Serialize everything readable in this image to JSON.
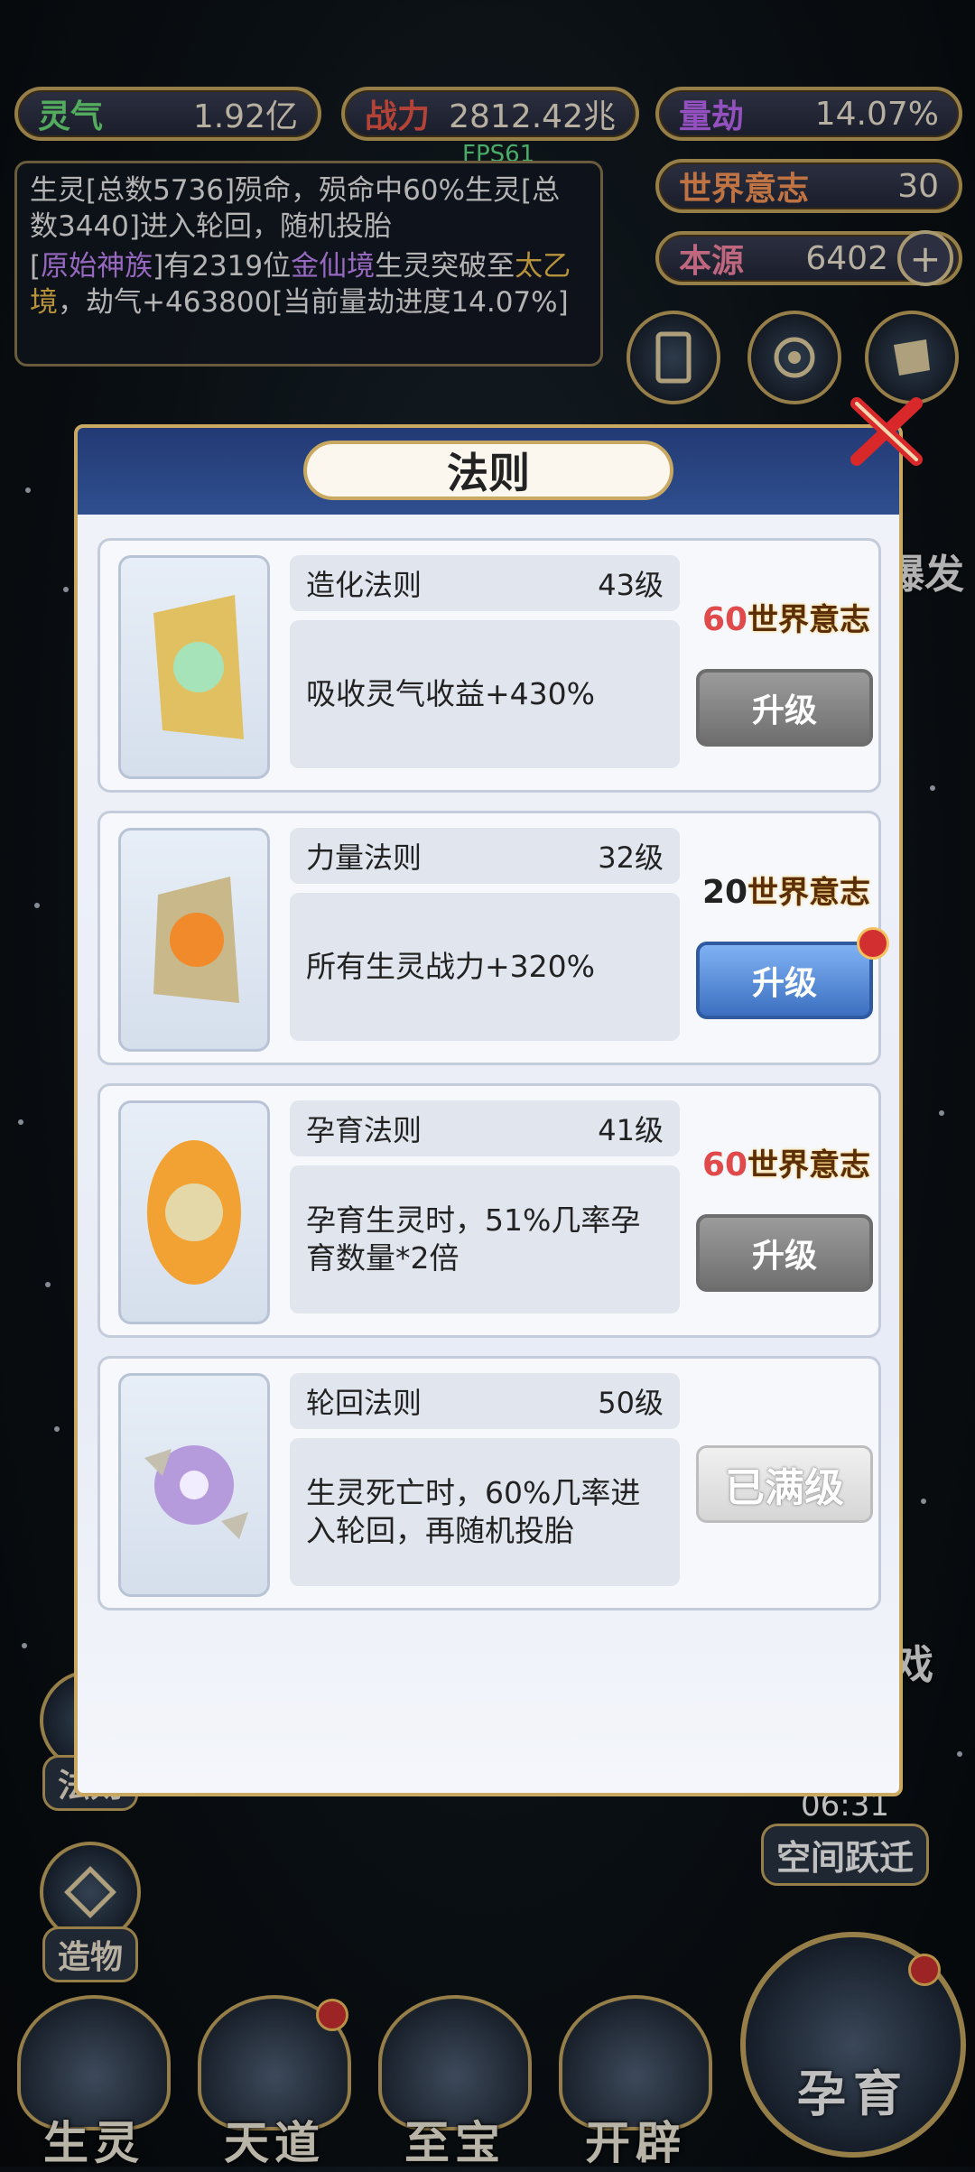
{
  "hud": {
    "lingqi": {
      "label": "灵气",
      "value": "1.92亿"
    },
    "zhanli": {
      "label": "战力",
      "value": "2812.42兆"
    },
    "liangjie": {
      "label": "量劫",
      "value": "14.07%"
    },
    "shijie": {
      "label": "世界意志",
      "value": "30"
    },
    "benyuan": {
      "label": "本源",
      "value": "6402"
    }
  },
  "fps": "FPS61",
  "log": {
    "line1": "生灵[总数5736]殒命，殒命中60%生灵[总数3440]进入轮回，随机投胎",
    "line2_prefix": "[",
    "line2_tribe": "原始神族",
    "line2_mid1": "]有2319位",
    "line2_realm1": "金仙境",
    "line2_mid2": "生灵突破至",
    "line2_realm2": "太乙境",
    "line2_suffix": "，劫气+463800[当前量劫进度14.07%]"
  },
  "modal": {
    "title": "法则",
    "laws": [
      {
        "name": "造化法则",
        "level": "43级",
        "desc": "吸收灵气收益+430%",
        "cost_num": "60",
        "cost_unit": "世界意志",
        "button": "升级"
      },
      {
        "name": "力量法则",
        "level": "32级",
        "desc": "所有生灵战力+320%",
        "cost_num": "20",
        "cost_unit": "世界意志",
        "button": "升级"
      },
      {
        "name": "孕育法则",
        "level": "41级",
        "desc": "孕育生灵时，51%几率孕育数量*2倍",
        "cost_num": "60",
        "cost_unit": "世界意志",
        "button": "升级"
      },
      {
        "name": "轮回法则",
        "level": "50级",
        "desc": "生灵死亡时，60%几率进入轮回，再随机投胎",
        "button": "已满级"
      }
    ]
  },
  "side": {
    "fa_ze": "法则",
    "zao_wu": "造物",
    "bao_fa": "爆发",
    "right_partial": "戏"
  },
  "jump": {
    "time": "06:31",
    "label": "空间跃迁"
  },
  "nav": [
    "生灵",
    "天道",
    "至宝",
    "开辟"
  ],
  "main_action": "孕育"
}
